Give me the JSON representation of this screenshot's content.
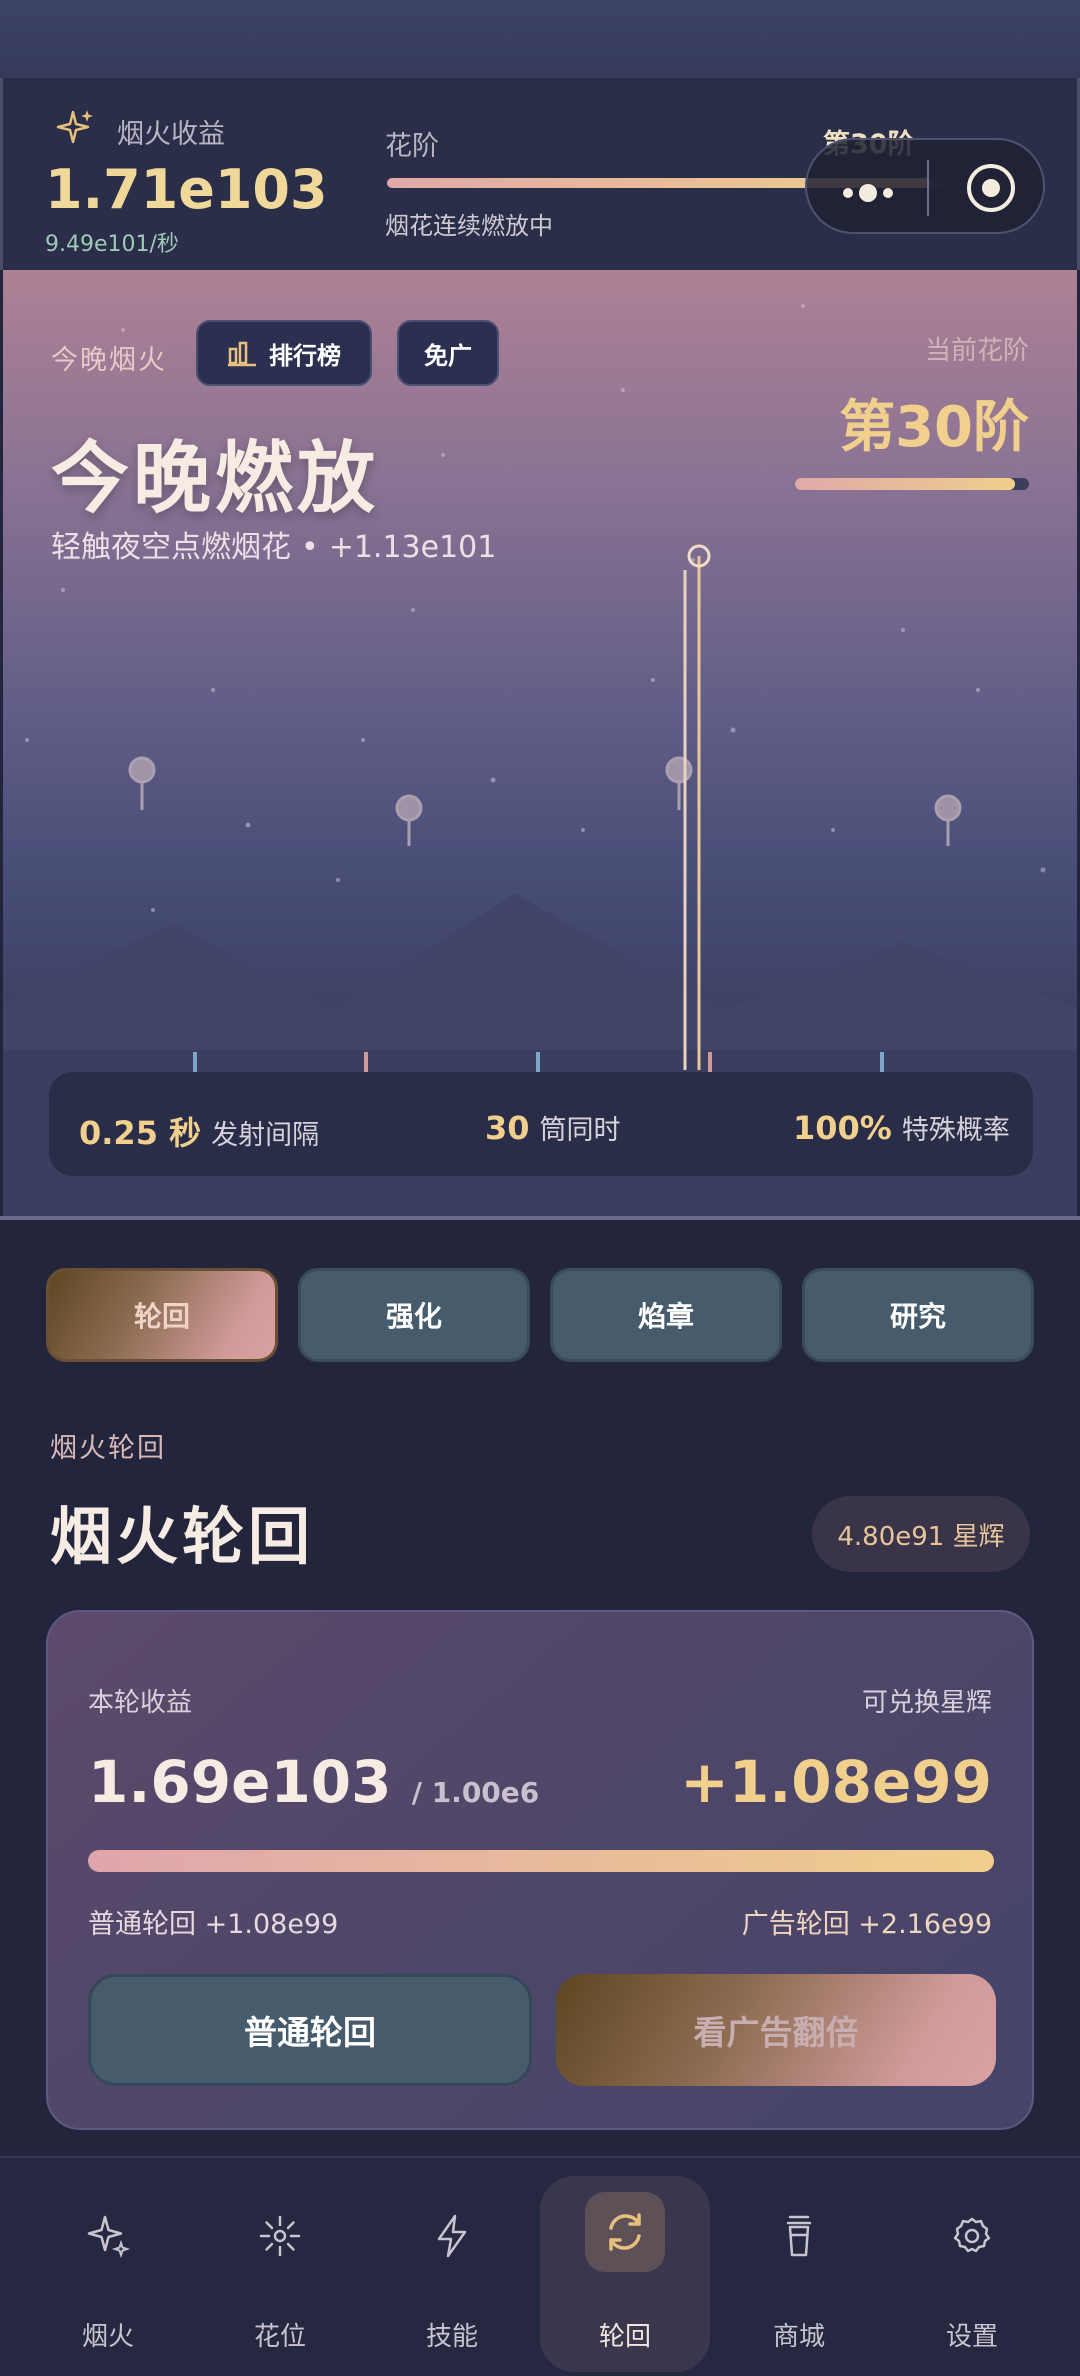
{
  "header": {
    "earnings_label": "烟火收益",
    "earnings_value": "1.71e103",
    "earnings_rate": "9.49e101/秒",
    "tier_label": "花阶",
    "tier_value": "第30阶",
    "tier_progress": 0.97,
    "tier_status": "烟花连续燃放中"
  },
  "hero": {
    "tonight_label": "今晚烟火",
    "rank_button": "排行榜",
    "no_ads_button": "免广",
    "title": "今晚燃放",
    "subtitle": "轻触夜空点燃烟花",
    "subtitle_dot": "•",
    "subtitle_gain": "+1.13e101",
    "current_tier_label": "当前花阶",
    "current_tier_value": "第30阶",
    "current_tier_progress": 0.94
  },
  "stats": [
    {
      "value": "0.25 秒",
      "label": "发射间隔"
    },
    {
      "value": "30",
      "label": "筒同时"
    },
    {
      "value": "100%",
      "label": "特殊概率"
    }
  ],
  "tabs": [
    {
      "label": "轮回",
      "active": true
    },
    {
      "label": "强化",
      "active": false
    },
    {
      "label": "焰章",
      "active": false
    },
    {
      "label": "研究",
      "active": false
    }
  ],
  "section": {
    "label": "烟火轮回",
    "title": "烟火轮回",
    "star_badge": "4.80e91 星辉"
  },
  "card": {
    "round_label": "本轮收益",
    "exchange_label": "可兑换星辉",
    "round_value": "1.69e103",
    "round_cap": "/ 1.00e6",
    "exchange_value": "+1.08e99",
    "progress": 1.0,
    "normal_text": "普通轮回 +1.08e99",
    "ad_text": "广告轮回 +2.16e99",
    "normal_button": "普通轮回",
    "ad_button": "看广告翻倍"
  },
  "nav": [
    {
      "label": "烟火",
      "icon": "sparkle-icon",
      "active": false
    },
    {
      "label": "花位",
      "icon": "firework-icon",
      "active": false
    },
    {
      "label": "技能",
      "icon": "lightning-icon",
      "active": false
    },
    {
      "label": "轮回",
      "icon": "refresh-icon",
      "active": true
    },
    {
      "label": "商城",
      "icon": "shop-icon",
      "active": false
    },
    {
      "label": "设置",
      "icon": "gear-icon",
      "active": false
    }
  ],
  "colors": {
    "accent_gold": "#f0d08c",
    "accent_pink": "#e0a9a7",
    "tab_teal": "#465b6b",
    "bg_dark": "#22253c"
  }
}
